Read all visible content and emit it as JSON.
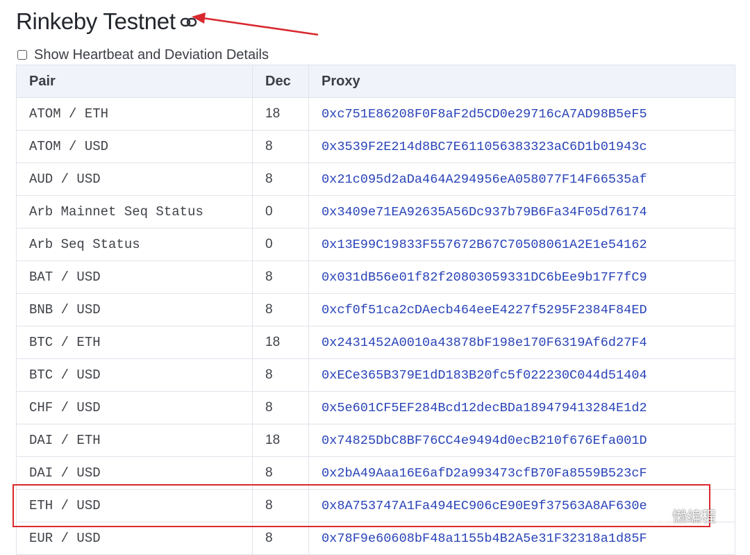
{
  "page": {
    "title": "Rinkeby Testnet",
    "toggle_label": "Show Heartbeat and Deviation Details",
    "toggle_checked": false
  },
  "table": {
    "headers": {
      "pair": "Pair",
      "dec": "Dec",
      "proxy": "Proxy"
    },
    "rows": [
      {
        "pair": "ATOM / ETH",
        "dec": "18",
        "proxy": "0xc751E86208F0F8aF2d5CD0e29716cA7AD98B5eF5"
      },
      {
        "pair": "ATOM / USD",
        "dec": "8",
        "proxy": "0x3539F2E214d8BC7E611056383323aC6D1b01943c"
      },
      {
        "pair": "AUD / USD",
        "dec": "8",
        "proxy": "0x21c095d2aDa464A294956eA058077F14F66535af"
      },
      {
        "pair": "Arb Mainnet Seq Status",
        "dec": "0",
        "proxy": "0x3409e71EA92635A56Dc937b79B6Fa34F05d76174"
      },
      {
        "pair": "Arb Seq Status",
        "dec": "0",
        "proxy": "0x13E99C19833F557672B67C70508061A2E1e54162"
      },
      {
        "pair": "BAT / USD",
        "dec": "8",
        "proxy": "0x031dB56e01f82f20803059331DC6bEe9b17F7fC9"
      },
      {
        "pair": "BNB / USD",
        "dec": "8",
        "proxy": "0xcf0f51ca2cDAecb464eeE4227f5295F2384F84ED"
      },
      {
        "pair": "BTC / ETH",
        "dec": "18",
        "proxy": "0x2431452A0010a43878bF198e170F6319Af6d27F4"
      },
      {
        "pair": "BTC / USD",
        "dec": "8",
        "proxy": "0xECe365B379E1dD183B20fc5f022230C044d51404"
      },
      {
        "pair": "CHF / USD",
        "dec": "8",
        "proxy": "0x5e601CF5EF284Bcd12decBDa189479413284E1d2"
      },
      {
        "pair": "DAI / ETH",
        "dec": "18",
        "proxy": "0x74825DbC8BF76CC4e9494d0ecB210f676Efa001D"
      },
      {
        "pair": "DAI / USD",
        "dec": "8",
        "proxy": "0x2bA49Aaa16E6afD2a993473cfB70Fa8559B523cF"
      },
      {
        "pair": "ETH / USD",
        "dec": "8",
        "proxy": "0x8A753747A1Fa494EC906cE90E9f37563A8AF630e",
        "highlighted": true
      },
      {
        "pair": "EUR / USD",
        "dec": "8",
        "proxy": "0x78F9e60608bF48a1155b4B2A5e31F32318a1d85F"
      }
    ]
  },
  "watermark": {
    "text": "懒编程",
    "icon": "wechat-icon"
  },
  "colors": {
    "link": "#2a44b8",
    "header_bg": "#f0f4fa",
    "border": "#dfe3ea",
    "annotation": "#d8282e"
  }
}
